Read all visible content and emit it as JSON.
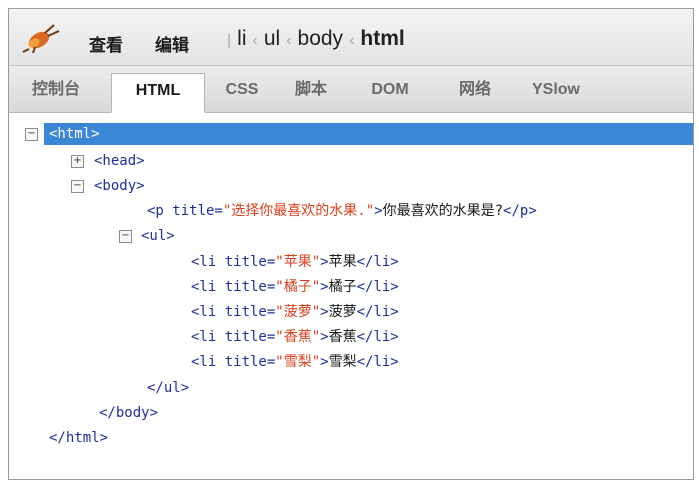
{
  "toolbar": {
    "menu_view": "查看",
    "menu_edit": "编辑",
    "breadcrumb": {
      "li": "li",
      "ul": "ul",
      "body": "body",
      "html": "html"
    },
    "icons": {
      "firebug": "bug-icon"
    }
  },
  "tabs": [
    {
      "label": "控制台"
    },
    {
      "label": "HTML"
    },
    {
      "label": "CSS"
    },
    {
      "label": "脚本"
    },
    {
      "label": "DOM"
    },
    {
      "label": "网络"
    },
    {
      "label": "YSlow"
    }
  ],
  "colors": {
    "selection": "#3b86d6",
    "tag": "#1d2f9c",
    "attribute_value": "#d9401d"
  },
  "tree": {
    "html_open": "<html>",
    "head": "<head>",
    "body_open": "<body>",
    "p": {
      "open": "<p title=",
      "value": "\"选择你最喜欢的水果.\"",
      "close_open": ">",
      "text": "你最喜欢的水果是?",
      "close": "</p>"
    },
    "ul_open": "<ul>",
    "items": [
      {
        "open": "<li title=",
        "value": "\"苹果\"",
        "mid": ">",
        "text": "苹果",
        "close": "</li>"
      },
      {
        "open": "<li title=",
        "value": "\"橘子\"",
        "mid": ">",
        "text": "橘子",
        "close": "</li>"
      },
      {
        "open": "<li title=",
        "value": "\"菠萝\"",
        "mid": ">",
        "text": "菠萝",
        "close": "</li>"
      },
      {
        "open": "<li title=",
        "value": "\"香蕉\"",
        "mid": ">",
        "text": "香蕉",
        "close": "</li>"
      },
      {
        "open": "<li title=",
        "value": "\"雪梨\"",
        "mid": ">",
        "text": "雪梨",
        "close": "</li>"
      }
    ],
    "ul_close": "</ul>",
    "body_close": "</body>",
    "html_close": "</html>"
  }
}
